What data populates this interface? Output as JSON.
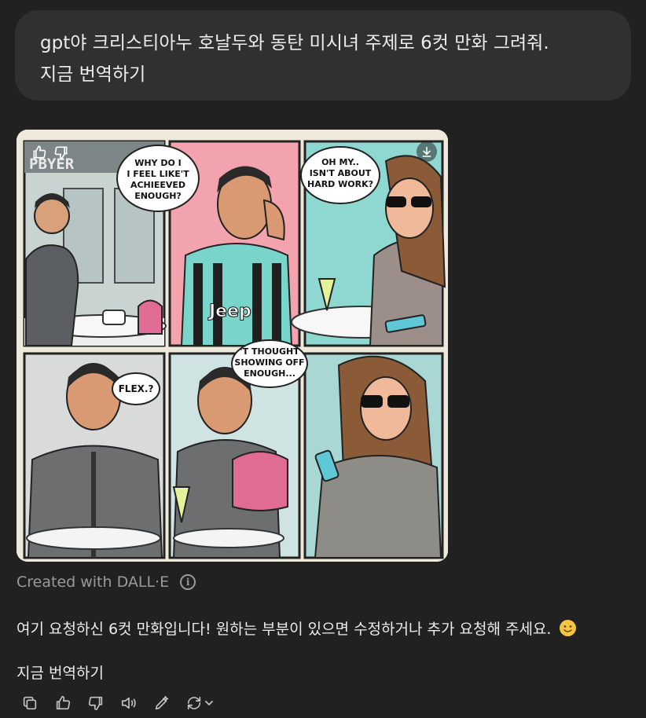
{
  "user_message": {
    "line1": "gpt야 크리스티아누 호날두와 동탄 미시녀 주제로 6컷 만화 그려줘.",
    "line2": "지금 번역하기"
  },
  "comic": {
    "sign_text": "PBYER",
    "panels": [
      {
        "bubble": [
          "WHY DO I",
          "I FEEL LIKE'T",
          "ACHIEEVED",
          "ENOUGH?"
        ]
      },
      {
        "bubble": [
          "OH MY..",
          "ISN'T ABOUT",
          "HARD WORK?"
        ]
      },
      {
        "bubble": [
          "FLEX.?"
        ]
      },
      {
        "bubble": [
          "'T THOUGHT",
          "SHOWING OFF",
          "ENOUGH..."
        ]
      }
    ],
    "shirt_logo": "Jeep"
  },
  "caption": {
    "text": "Created with DALL·E",
    "info_icon": "info-icon"
  },
  "assistant": {
    "message": "여기 요청하신 6컷 만화입니다! 원하는 부분이 있으면 수정하거나 추가 요청해 주세요.",
    "emoji": "smiling-face-emoji",
    "translate": "지금 번역하기"
  },
  "actions": [
    "copy-icon",
    "thumbs-up-icon",
    "thumbs-down-icon",
    "read-aloud-icon",
    "edit-icon",
    "regenerate-icon"
  ],
  "colors": {
    "background": "#212121",
    "user_bubble": "#303030",
    "text": "#ececec",
    "muted": "#9a9a9a"
  }
}
